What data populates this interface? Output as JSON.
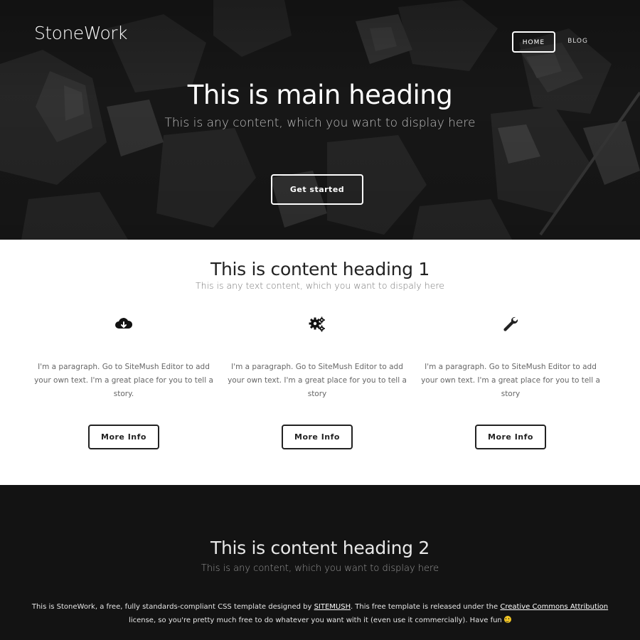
{
  "site": {
    "logo": "StoneWork"
  },
  "nav": {
    "items": [
      "HOME",
      "BLOG"
    ],
    "active": "HOME"
  },
  "hero": {
    "title": "This is main heading",
    "subtitle": "This is any content, which you want to display here",
    "cta_label": "Get started"
  },
  "section1": {
    "title": "This is content heading 1",
    "subtitle": "This is any text content, which you want to dispaly here",
    "features": [
      {
        "icon": "cloud-download-icon",
        "text": "I'm a paragraph. Go to SiteMush Editor to add your own text. I'm a great place for you to tell a story.",
        "button": "More Info"
      },
      {
        "icon": "gears-icon",
        "text": "I'm a paragraph. Go to SiteMush Editor to add your own text. I'm a great place for you to tell a story",
        "button": "More Info"
      },
      {
        "icon": "wrench-icon",
        "text": "I'm a paragraph. Go to SiteMush Editor to add your own text. I'm a great place for you to tell a story",
        "button": "More Info"
      }
    ]
  },
  "section2": {
    "title": "This is content heading 2",
    "subtitle": "This is any content, which you want to display here",
    "text_1": "This is StoneWork, a free, fully standards-compliant CSS template designed by ",
    "link_1": "SITEMUSH",
    "text_2": ". This free template is released under the ",
    "link_2": "Creative Commons Attribution",
    "text_3": " license, so you're pretty much free to do whatever you want with it (even use it commercially). Have fun "
  },
  "colors": {
    "hero_bg": "#1e1e1e",
    "dark_section": "#131313",
    "text_dark": "#222222",
    "smiley": "#f3c623"
  }
}
